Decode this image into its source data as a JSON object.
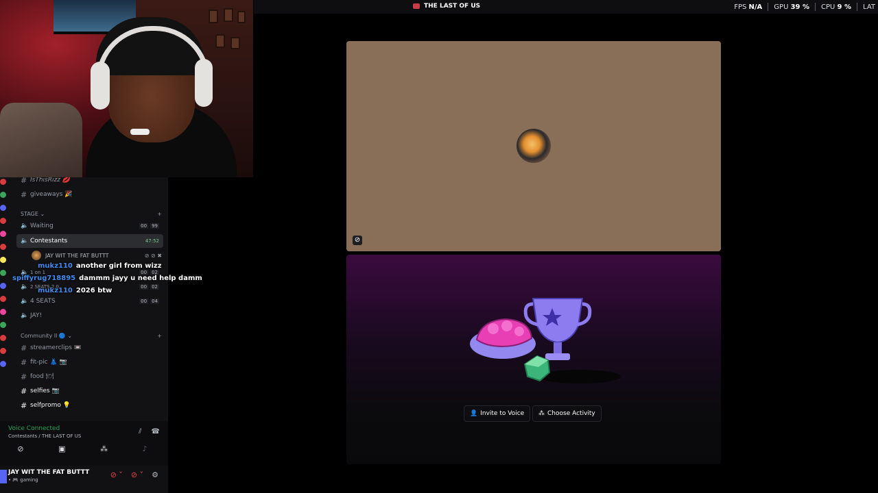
{
  "topbar": {
    "title": "THE LAST OF US",
    "stats": [
      {
        "label": "FPS",
        "value": "N/A"
      },
      {
        "label": "GPU",
        "value": "39 %"
      },
      {
        "label": "CPU",
        "value": "9 %"
      },
      {
        "label": "LAT",
        "value": ""
      }
    ]
  },
  "sidebar": {
    "channels_top": [
      {
        "name": "IsThisRizz 💋"
      },
      {
        "name": "giveaways 🎉"
      }
    ],
    "stage_category": "STAGE",
    "stage_channels": [
      {
        "name": "Waiting",
        "count": "00",
        "limit": "99"
      },
      {
        "name": "Contestants",
        "time": "47:52"
      }
    ],
    "member": "JAY WIT THE FAT BUTTT",
    "voice_channels": [
      {
        "name": "1 on 1",
        "count": "00",
        "limit": "02"
      },
      {
        "name": "2 SEATS 2.0",
        "count": "00",
        "limit": "02"
      },
      {
        "name": "4 SEATS",
        "count": "00",
        "limit": "04"
      },
      {
        "name": "JAY!"
      }
    ],
    "community_category": "Community ll 🔵",
    "community_channels": [
      {
        "name": "streamerclips 📼"
      },
      {
        "name": "fit-pic 👗 📷"
      },
      {
        "name": "food 🍽"
      },
      {
        "name": "selfies 📷"
      },
      {
        "name": "selfpromo 💡"
      }
    ]
  },
  "chat_overlay": [
    {
      "user": "mukz110",
      "message": "another girl from wizz"
    },
    {
      "user": "spiffyrug718895",
      "message": "dammm jayy u need help damm"
    },
    {
      "user": "mukz110",
      "message": "2026 btw"
    }
  ],
  "voice_panel": {
    "status": "Voice Connected",
    "location": "Contestants / THE LAST OF US"
  },
  "user_panel": {
    "name": "JAY WIT THE FAT BUTTT",
    "status": "• 🎮 gaming"
  },
  "stage": {
    "invite_label": "Invite to Voice",
    "activity_label": "Choose Activity"
  },
  "colors": {
    "tile_bg": "#8a6f58",
    "voice_connected": "#23a55a",
    "chat_user": "#3d8cf0",
    "muted": "#f23f43"
  }
}
